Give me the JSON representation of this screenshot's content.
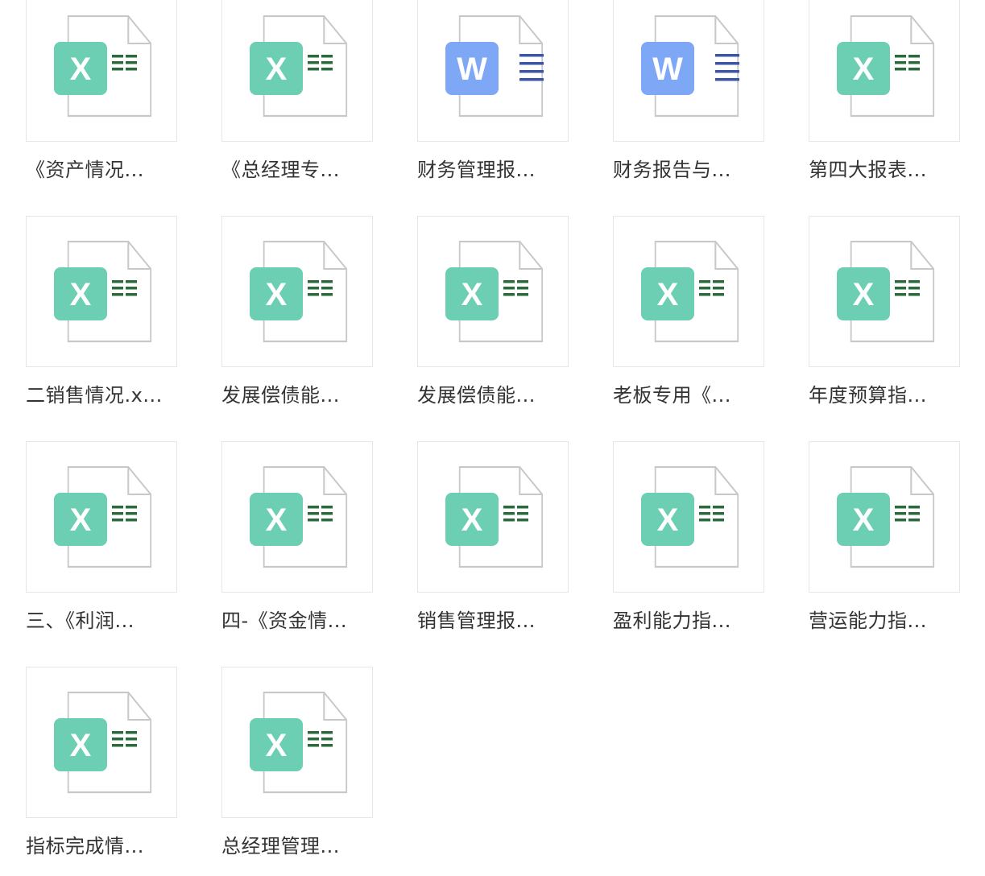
{
  "colors": {
    "excel_badge": "#6ccfb3",
    "excel_lines": "#2b6a3b",
    "word_badge": "#7ea7f5",
    "word_lines": "#3b55a8",
    "tile_border": "#e6e6e6",
    "text": "#333333"
  },
  "files": [
    {
      "type": "excel",
      "letter": "X",
      "name": "《资产情况..."
    },
    {
      "type": "excel",
      "letter": "X",
      "name": "《总经理专..."
    },
    {
      "type": "word",
      "letter": "W",
      "name": "财务管理报..."
    },
    {
      "type": "word",
      "letter": "W",
      "name": "财务报告与..."
    },
    {
      "type": "excel",
      "letter": "X",
      "name": "第四大报表..."
    },
    {
      "type": "excel",
      "letter": "X",
      "name": "二销售情况.x..."
    },
    {
      "type": "excel",
      "letter": "X",
      "name": "发展偿债能..."
    },
    {
      "type": "excel",
      "letter": "X",
      "name": "发展偿债能..."
    },
    {
      "type": "excel",
      "letter": "X",
      "name": "老板专用《..."
    },
    {
      "type": "excel",
      "letter": "X",
      "name": "年度预算指..."
    },
    {
      "type": "excel",
      "letter": "X",
      "name": "三、《利润..."
    },
    {
      "type": "excel",
      "letter": "X",
      "name": "四-《资金情..."
    },
    {
      "type": "excel",
      "letter": "X",
      "name": "销售管理报..."
    },
    {
      "type": "excel",
      "letter": "X",
      "name": "盈利能力指..."
    },
    {
      "type": "excel",
      "letter": "X",
      "name": "营运能力指..."
    },
    {
      "type": "excel",
      "letter": "X",
      "name": "指标完成情..."
    },
    {
      "type": "excel",
      "letter": "X",
      "name": "总经理管理..."
    }
  ]
}
